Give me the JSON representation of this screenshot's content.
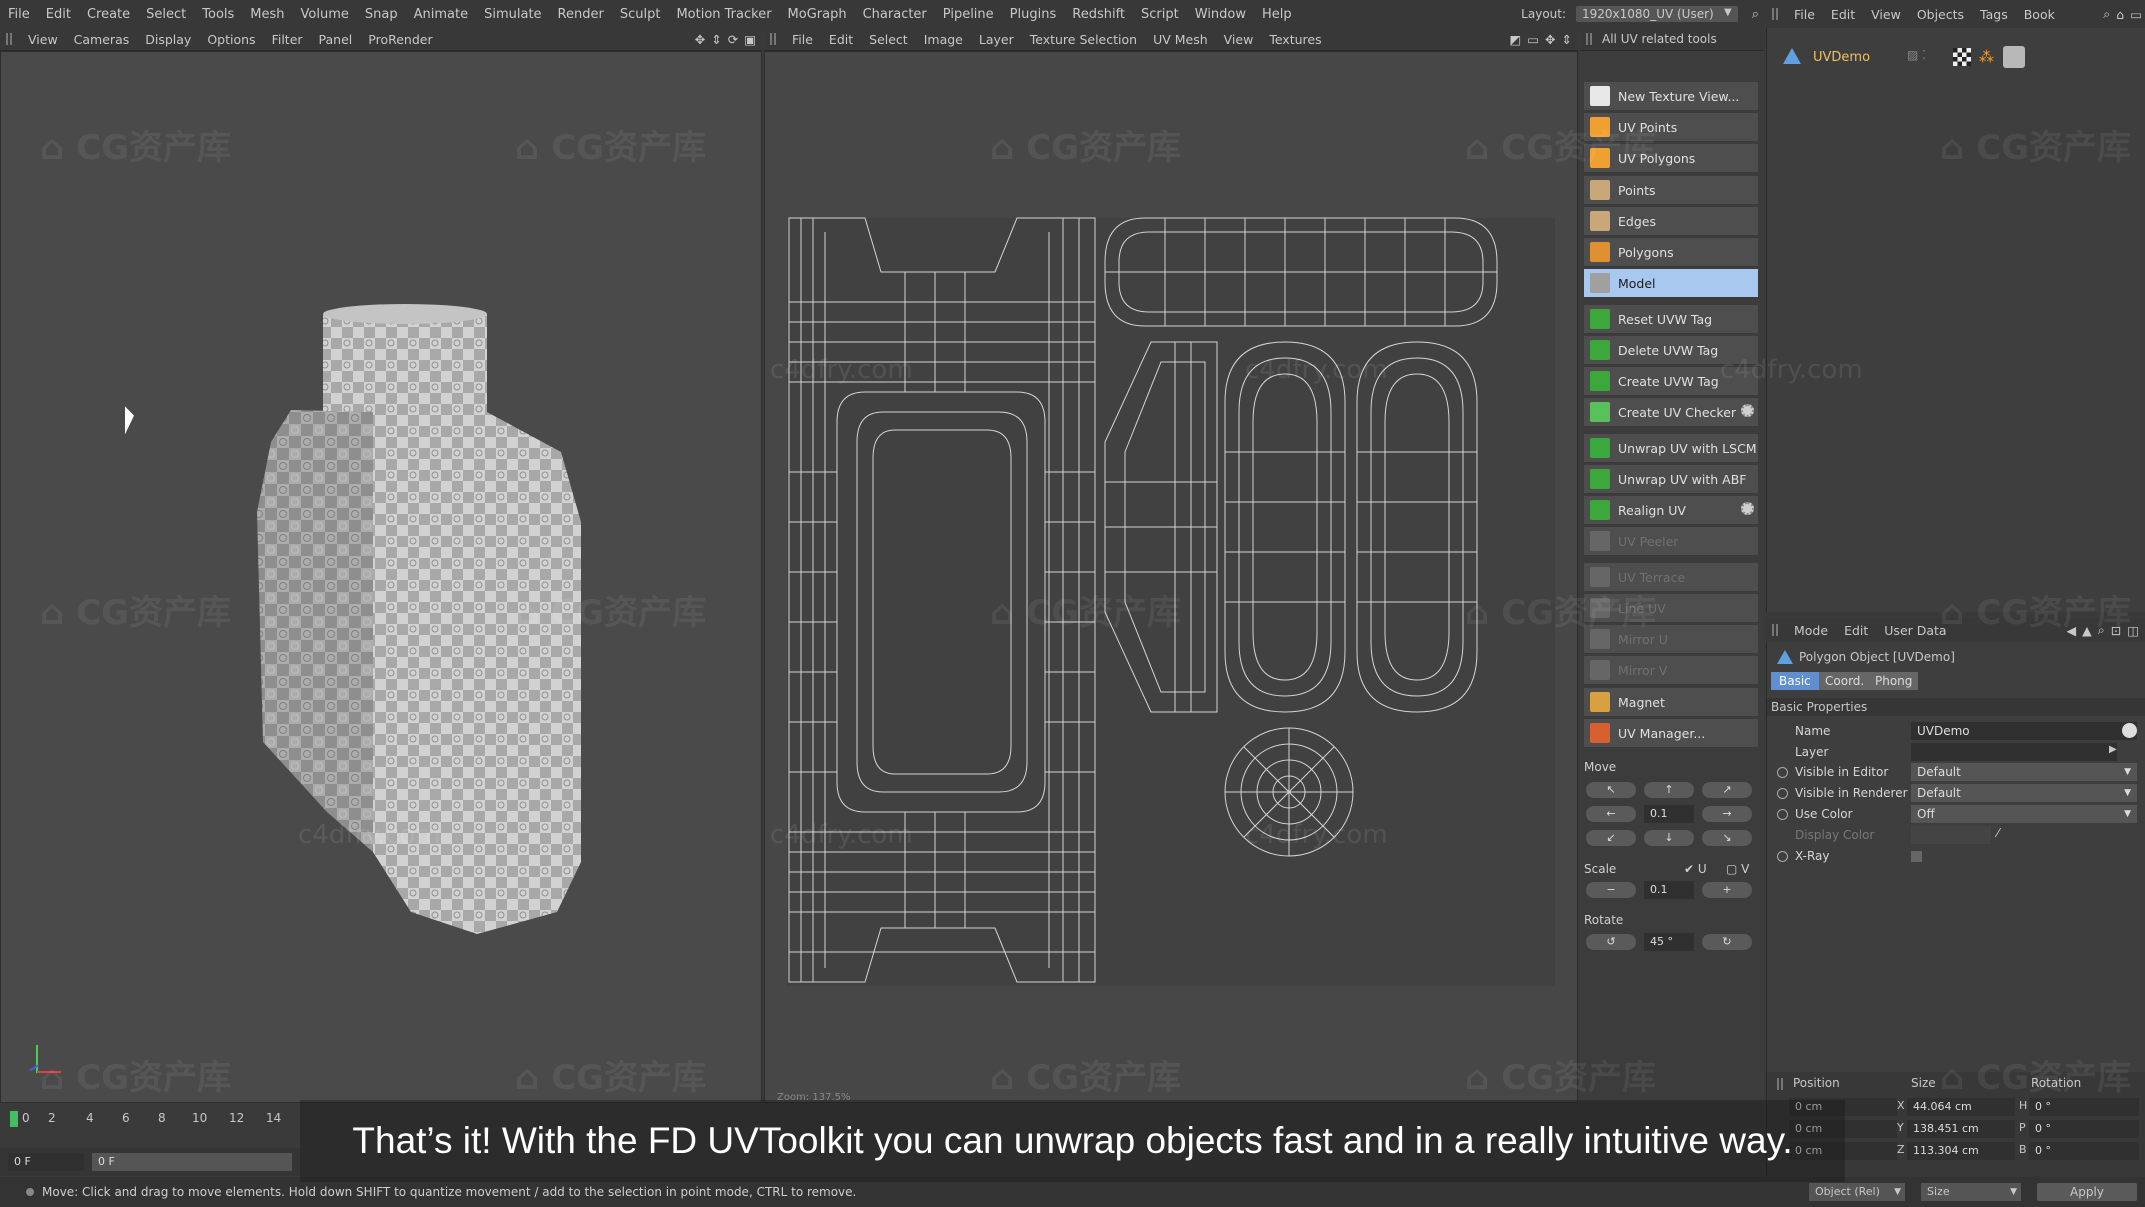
{
  "menubar": {
    "items": [
      "File",
      "Edit",
      "Create",
      "Select",
      "Tools",
      "Mesh",
      "Volume",
      "Snap",
      "Animate",
      "Simulate",
      "Render",
      "Sculpt",
      "Motion Tracker",
      "MoGraph",
      "Character",
      "Pipeline",
      "Plugins",
      "Redshift",
      "Script",
      "Window",
      "Help"
    ],
    "layout_label": "Layout:",
    "layout_value": "1920x1080_UV (User)"
  },
  "viewport_bar": {
    "items": [
      "View",
      "Cameras",
      "Display",
      "Options",
      "Filter",
      "Panel",
      "ProRender"
    ]
  },
  "uv_bar": {
    "items": [
      "File",
      "Edit",
      "Select",
      "Image",
      "Layer",
      "Texture Selection",
      "UV Mesh",
      "View",
      "Textures"
    ]
  },
  "uv_status": "Zoom: 137.5%",
  "tools_panel": {
    "title": "All UV related tools",
    "items": [
      {
        "label": "New Texture View...",
        "state": "normal",
        "icon_color": "#e8e8e8"
      },
      {
        "label": "UV Points",
        "state": "normal",
        "icon_color": "#f0a030"
      },
      {
        "label": "UV Polygons",
        "state": "normal",
        "icon_color": "#f0a030"
      },
      {
        "label": "Points",
        "state": "normal",
        "icon_color": "#c8a878"
      },
      {
        "label": "Edges",
        "state": "normal",
        "icon_color": "#c8a878"
      },
      {
        "label": "Polygons",
        "state": "normal",
        "icon_color": "#e09030"
      },
      {
        "label": "Model",
        "state": "selected",
        "icon_color": "#a0a0a0"
      },
      {
        "label": "Reset UVW Tag",
        "state": "normal",
        "icon_color": "#3ca83c"
      },
      {
        "label": "Delete UVW Tag",
        "state": "normal",
        "icon_color": "#3ca83c"
      },
      {
        "label": "Create UVW Tag",
        "state": "normal",
        "icon_color": "#3ca83c"
      },
      {
        "label": "Create UV Checker",
        "state": "normal",
        "icon_color": "#5ac05a",
        "gear": true
      },
      {
        "label": "Unwrap UV with LSCM",
        "state": "normal",
        "icon_color": "#3ca83c"
      },
      {
        "label": "Unwrap UV with ABF",
        "state": "normal",
        "icon_color": "#3ca83c"
      },
      {
        "label": "Realign UV",
        "state": "normal",
        "icon_color": "#3ca83c",
        "gear": true
      },
      {
        "label": "UV Peeler",
        "state": "disabled",
        "icon_color": "#666666"
      },
      {
        "label": "UV Terrace",
        "state": "disabled",
        "icon_color": "#666666"
      },
      {
        "label": "Line UV",
        "state": "disabled",
        "icon_color": "#666666"
      },
      {
        "label": "Mirror U",
        "state": "disabled",
        "icon_color": "#666666"
      },
      {
        "label": "Mirror V",
        "state": "disabled",
        "icon_color": "#666666"
      },
      {
        "label": "Magnet",
        "state": "normal",
        "icon_color": "#d8a040"
      },
      {
        "label": "UV Manager...",
        "state": "normal",
        "icon_color": "#d86030"
      }
    ],
    "move_label": "Move",
    "move_step": "0.1",
    "scale_label": "Scale",
    "scale_u": "U",
    "scale_v": "V",
    "scale_step": "0.1",
    "scale_minus": "−",
    "scale_plus": "+",
    "rotate_label": "Rotate",
    "rotate_step": "45 °"
  },
  "objects_bar": {
    "items": [
      "File",
      "Edit",
      "View",
      "Objects",
      "Tags",
      "Book"
    ]
  },
  "object_name": "UVDemo",
  "attributes": {
    "bar_items": [
      "Mode",
      "Edit",
      "User Data"
    ],
    "object_title": "Polygon Object [UVDemo]",
    "tabs": [
      "Basic",
      "Coord.",
      "Phong"
    ],
    "section": "Basic Properties",
    "props": [
      {
        "label": "Name",
        "value": "UVDemo"
      },
      {
        "label": "Layer",
        "value": ""
      },
      {
        "label": "Visible in Editor",
        "value": "Default"
      },
      {
        "label": "Visible in Renderer",
        "value": "Default"
      },
      {
        "label": "Use Color",
        "value": "Off"
      },
      {
        "label": "Display Color",
        "value": ""
      },
      {
        "label": "X-Ray",
        "value": ""
      }
    ]
  },
  "coords": {
    "headers": [
      "Position",
      "Size",
      "Rotation"
    ],
    "pos_x": "0 cm",
    "pos_y": "0 cm",
    "pos_z": "0 cm",
    "size_x": "44.064 cm",
    "size_y": "138.451 cm",
    "size_z": "113.304 cm",
    "rot_h": "0 °",
    "rot_p": "0 °",
    "rot_b": "0 °",
    "mode_value": "Object (Rel)",
    "size_mode": "Size",
    "apply": "Apply"
  },
  "timeline": {
    "ticks": [
      "0",
      "2",
      "4",
      "6",
      "8",
      "10",
      "12",
      "14"
    ],
    "frame": "0 F",
    "frame2": "0 F"
  },
  "status": "Move: Click and drag to move elements. Hold down SHIFT to quantize movement / add to the selection in point mode, CTRL to remove.",
  "subtitle": "That’s it! With the FD UVToolkit you can unwrap objects fast and in a really intuitive way.",
  "watermarks": {
    "cg": "CG资产库",
    "c4d": "c4dfry.com"
  }
}
